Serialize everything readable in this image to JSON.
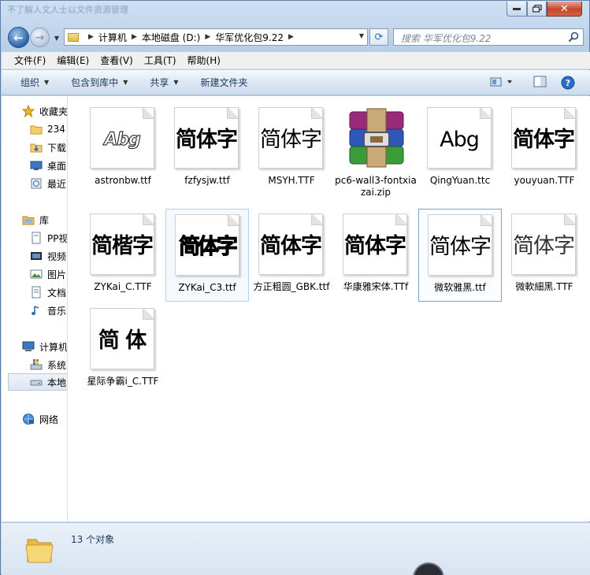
{
  "window": {
    "title": "不了解人文人士以文件资源管理"
  },
  "address": {
    "segments": [
      "计算机",
      "本地磁盘 (D:)",
      "华军优化包9.22"
    ]
  },
  "search": {
    "placeholder": "搜索 华军优化包9.22"
  },
  "menu": [
    "文件(F)",
    "编辑(E)",
    "查看(V)",
    "工具(T)",
    "帮助(H)"
  ],
  "commands": {
    "organize": "组织",
    "include_library": "包含到库中",
    "share": "共享",
    "new_folder": "新建文件夹"
  },
  "navpane": {
    "favorites": "收藏夹",
    "fav_items": [
      "234",
      "下载",
      "桌面",
      "最近"
    ],
    "library": "库",
    "lib_items": [
      "PP视",
      "视频",
      "图片",
      "文档",
      "音乐"
    ],
    "computer": "计算机",
    "comp_items": [
      "系统",
      "本地"
    ],
    "network": "网络"
  },
  "files": [
    {
      "name": "astronbw.ttf",
      "preview": "Abg",
      "kind": "font",
      "style": "italic-outline"
    },
    {
      "name": "fzfysjw.ttf",
      "preview": "简体字",
      "kind": "font",
      "style": "bold"
    },
    {
      "name": "MSYH.TTF",
      "preview": "简体字",
      "kind": "font",
      "style": "regular"
    },
    {
      "name": "pc6-wall3-fontxiazai.zip",
      "preview": "",
      "kind": "zip",
      "style": "winrar"
    },
    {
      "name": "QingYuan.ttc",
      "preview": "Abg",
      "kind": "font",
      "style": "regular"
    },
    {
      "name": "youyuan.TTF",
      "preview": "简体字",
      "kind": "font",
      "style": "bold"
    },
    {
      "name": "ZYKai_C.TTF",
      "preview": "简楷字",
      "kind": "font",
      "style": "bold"
    },
    {
      "name": "ZYKai_C3.ttf",
      "preview": "简体字",
      "kind": "font",
      "style": "outline-bold"
    },
    {
      "name": "方正粗圆_GBK.ttf",
      "preview": "简体字",
      "kind": "font",
      "style": "bold"
    },
    {
      "name": "华康雅宋体.TTf",
      "preview": "简体字",
      "kind": "font",
      "style": "bold"
    },
    {
      "name": "微软雅黑.ttf",
      "preview": "简体字",
      "kind": "font",
      "style": "regular"
    },
    {
      "name": "微軟細黑.TTF",
      "preview": "简体字",
      "kind": "font",
      "style": "light"
    },
    {
      "name": "星际争霸i_C.TTF",
      "preview": "简 体",
      "kind": "font",
      "style": "bold"
    }
  ],
  "status": {
    "count_text": "13 个对象"
  },
  "colors": {
    "accent": "#2c6cb8",
    "command_text": "#1e395b",
    "selection_border": "#7da2ce"
  }
}
